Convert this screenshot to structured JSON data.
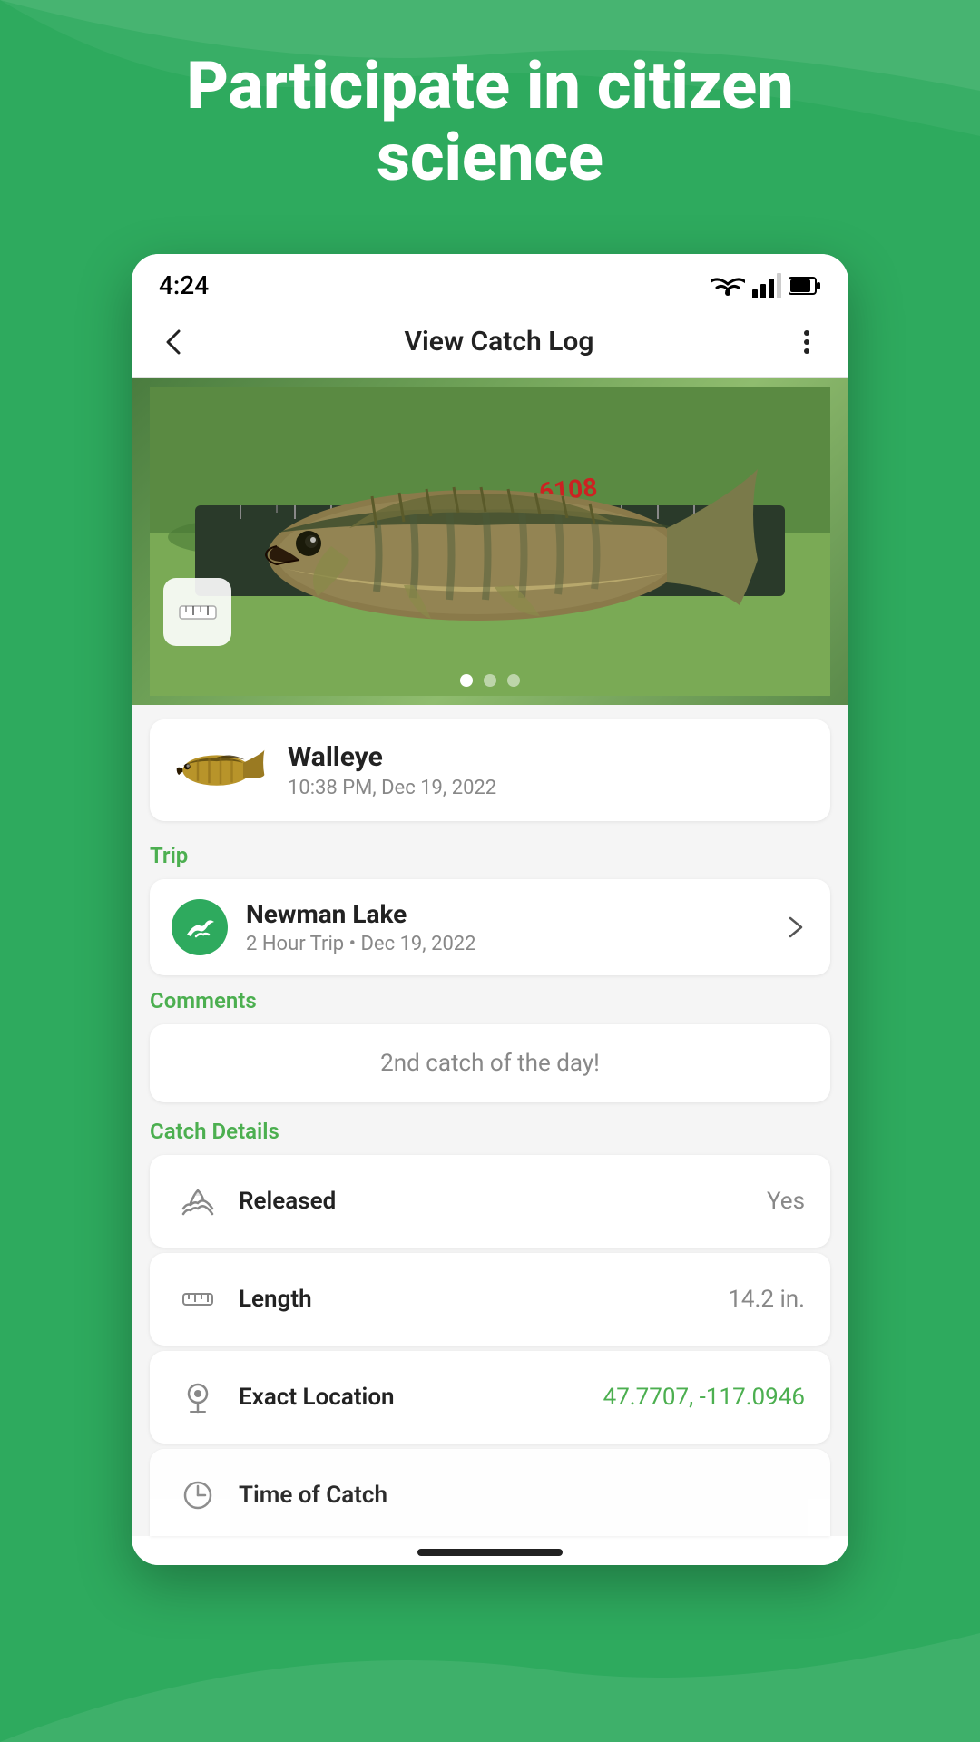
{
  "background": {
    "color": "#2eaa5e"
  },
  "hero": {
    "text": "Participate in citizen science"
  },
  "status_bar": {
    "time": "4:24",
    "icons": [
      "wifi",
      "signal",
      "battery"
    ]
  },
  "app_bar": {
    "title": "View Catch Log",
    "back_label": "←",
    "more_label": "⋮"
  },
  "photo": {
    "dots": 3,
    "active_dot": 0
  },
  "fish_card": {
    "name": "Walleye",
    "datetime": "10:38 PM, Dec 19, 2022"
  },
  "trip_section": {
    "label": "Trip",
    "name": "Newman Lake",
    "subtitle": "2 Hour Trip • Dec 19, 2022"
  },
  "comments_section": {
    "label": "Comments",
    "text": "2nd catch of the day!"
  },
  "catch_details": {
    "label": "Catch Details",
    "items": [
      {
        "id": "released",
        "label": "Released",
        "value": "Yes",
        "value_color": "normal"
      },
      {
        "id": "length",
        "label": "Length",
        "value": "14.2 in.",
        "value_color": "normal"
      },
      {
        "id": "exact-location",
        "label": "Exact Location",
        "value": "47.7707, -117.0946",
        "value_color": "link"
      }
    ],
    "partial_item": {
      "label": "Time of Catch",
      "value": "..."
    }
  }
}
